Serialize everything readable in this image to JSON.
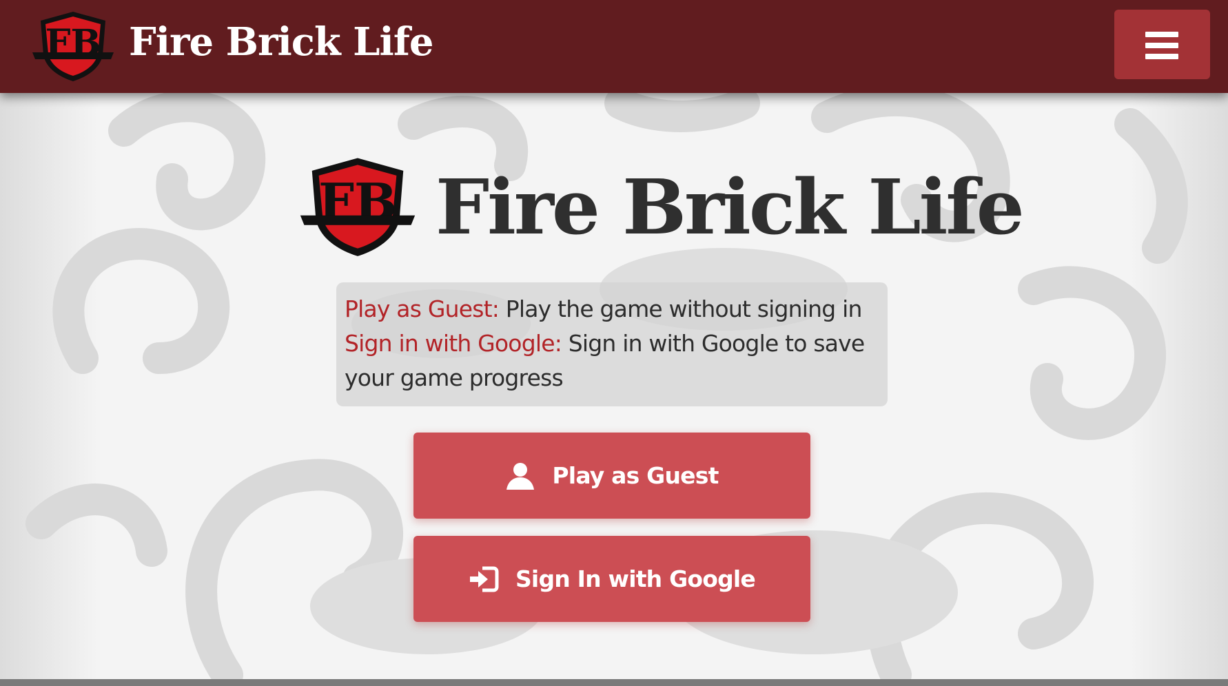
{
  "app": {
    "title": "Fire Brick Life",
    "logo_letters": "FB"
  },
  "navbar": {
    "title": "Fire Brick Life",
    "menu_icon": "hamburger-menu-icon"
  },
  "hero": {
    "title": "Fire Brick Life"
  },
  "info": {
    "items": [
      {
        "key": "Play as Guest:",
        "text": " Play the game without signing in"
      },
      {
        "key": "Sign in with Google:",
        "text": " Sign in with Google to save your game progress"
      }
    ]
  },
  "buttons": {
    "guest": {
      "label": "Play as Guest",
      "icon": "user-icon"
    },
    "google": {
      "label": "Sign In with Google",
      "icon": "sign-in-icon"
    }
  },
  "colors": {
    "navbar": "#611c1f",
    "menu_button": "#a33236",
    "accent_text": "#b22327",
    "button": "#cc4e54",
    "title_text": "#2f2f2f"
  }
}
